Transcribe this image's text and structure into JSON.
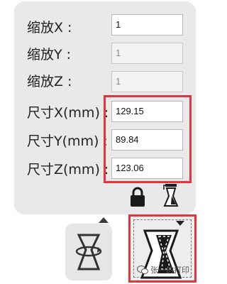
{
  "scale": {
    "x": {
      "label": "缩放X :",
      "value": "1"
    },
    "y": {
      "label": "缩放Y :",
      "value": "1"
    },
    "z": {
      "label": "缩放Z :",
      "value": "1"
    }
  },
  "size": {
    "x": {
      "label": "尺寸X(mm) :",
      "value": "129.15"
    },
    "y": {
      "label": "尺寸Y(mm) :",
      "value": "89.84"
    },
    "z": {
      "label": "尺寸Z(mm) :",
      "value": "123.06"
    }
  },
  "icons": {
    "lock": "lock-icon",
    "uniform_scale": "uniform-scale-icon",
    "rotate": "rotate-icon",
    "scale": "scale-icon",
    "wechat": "wechat-icon"
  },
  "watermark": "张一的打印",
  "colors": {
    "highlight": "#e0373f",
    "panel": "#e9e9e9"
  }
}
